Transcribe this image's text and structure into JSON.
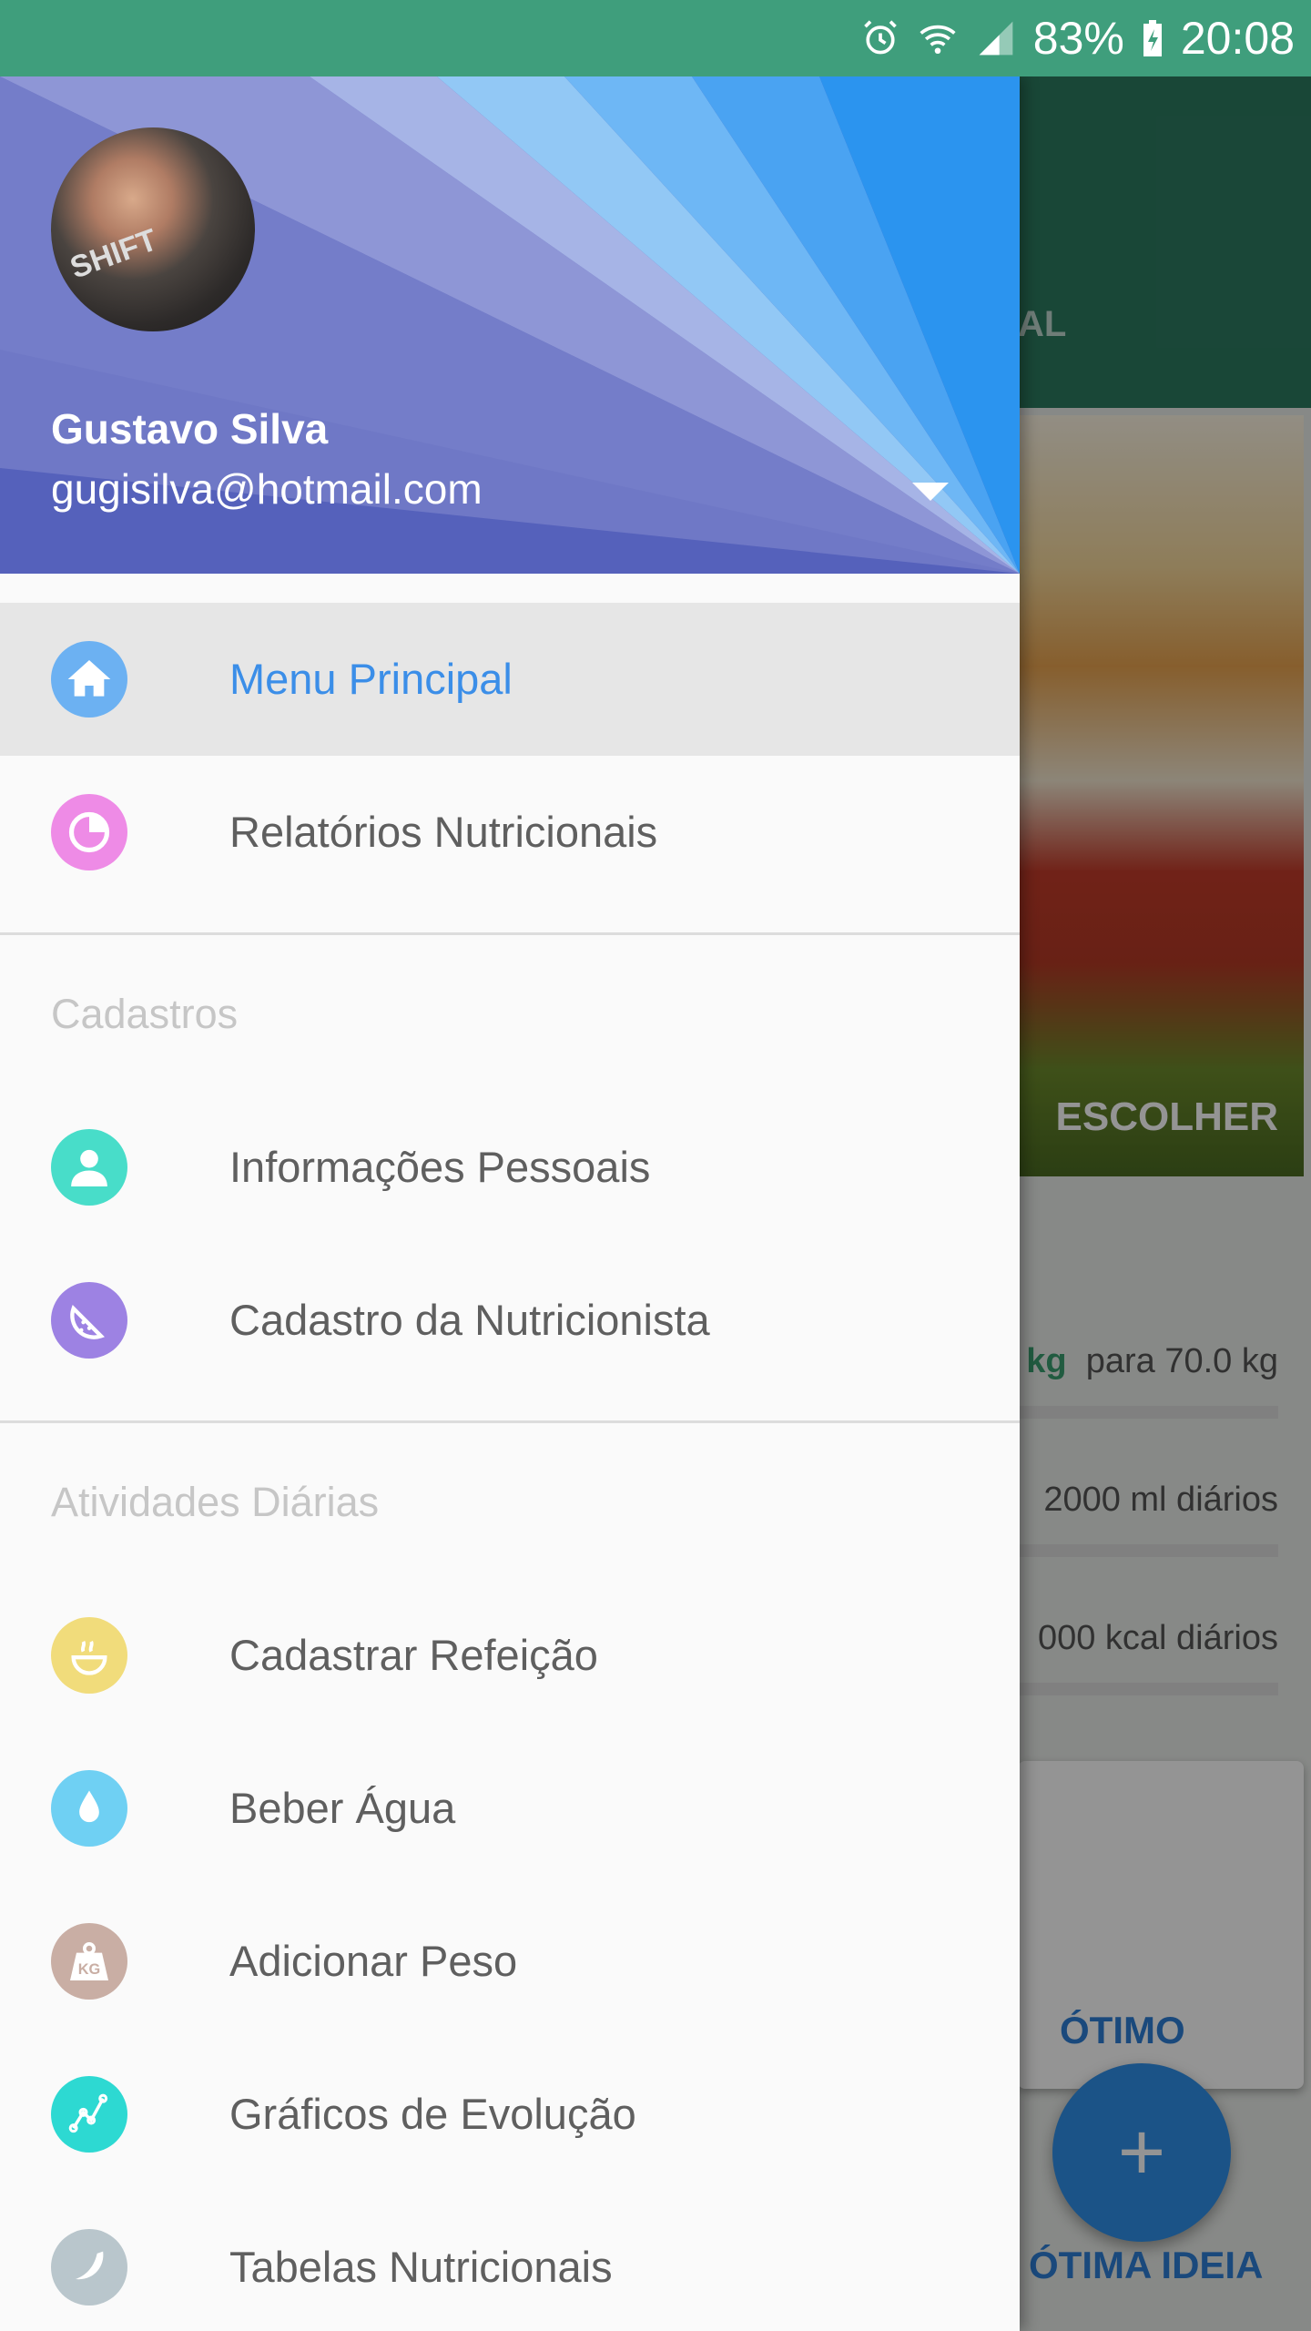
{
  "status_bar": {
    "battery": "83%",
    "time": "20:08"
  },
  "background": {
    "tab_fragment": "AL",
    "image_action": "ESCOLHER",
    "weight_unit": "kg",
    "weight_goal": "para  70.0 kg",
    "water_goal": "2000 ml diários",
    "calorie_goal": "000 kcal diários",
    "card_action": "ÓTIMO",
    "fab_symbol": "+",
    "bottom_action": "ÓTIMA IDEIA"
  },
  "drawer": {
    "user": {
      "name": "Gustavo Silva",
      "email": "gugisilva@hotmail.com",
      "avatar_text": "SHIFT"
    },
    "items_top": [
      {
        "label": "Menu Principal",
        "icon": "home-icon",
        "color": "#6cb1f2",
        "active": true
      },
      {
        "label": "Relatórios Nutricionais",
        "icon": "pie-chart-icon",
        "color": "#ee8be6",
        "active": false
      }
    ],
    "section_cadastros": {
      "title": "Cadastros",
      "items": [
        {
          "label": "Informações Pessoais",
          "icon": "person-icon",
          "color": "#48ddc9"
        },
        {
          "label": "Cadastro da Nutricionista",
          "icon": "watermelon-icon",
          "color": "#9d82e3"
        }
      ]
    },
    "section_atividades": {
      "title": "Atividades Diárias",
      "items": [
        {
          "label": "Cadastrar Refeição",
          "icon": "meal-bowl-icon",
          "color": "#f1dc7b"
        },
        {
          "label": "Beber Água",
          "icon": "water-drop-icon",
          "color": "#6fd0f3"
        },
        {
          "label": "Adicionar Peso",
          "icon": "weight-icon",
          "color": "#c9aea4",
          "icon_text": "KG"
        },
        {
          "label": "Gráficos de Evolução",
          "icon": "graph-icon",
          "color": "#2dd9d2"
        },
        {
          "label": "Tabelas Nutricionais",
          "icon": "banana-icon",
          "color": "#b9c6cc"
        }
      ]
    }
  }
}
